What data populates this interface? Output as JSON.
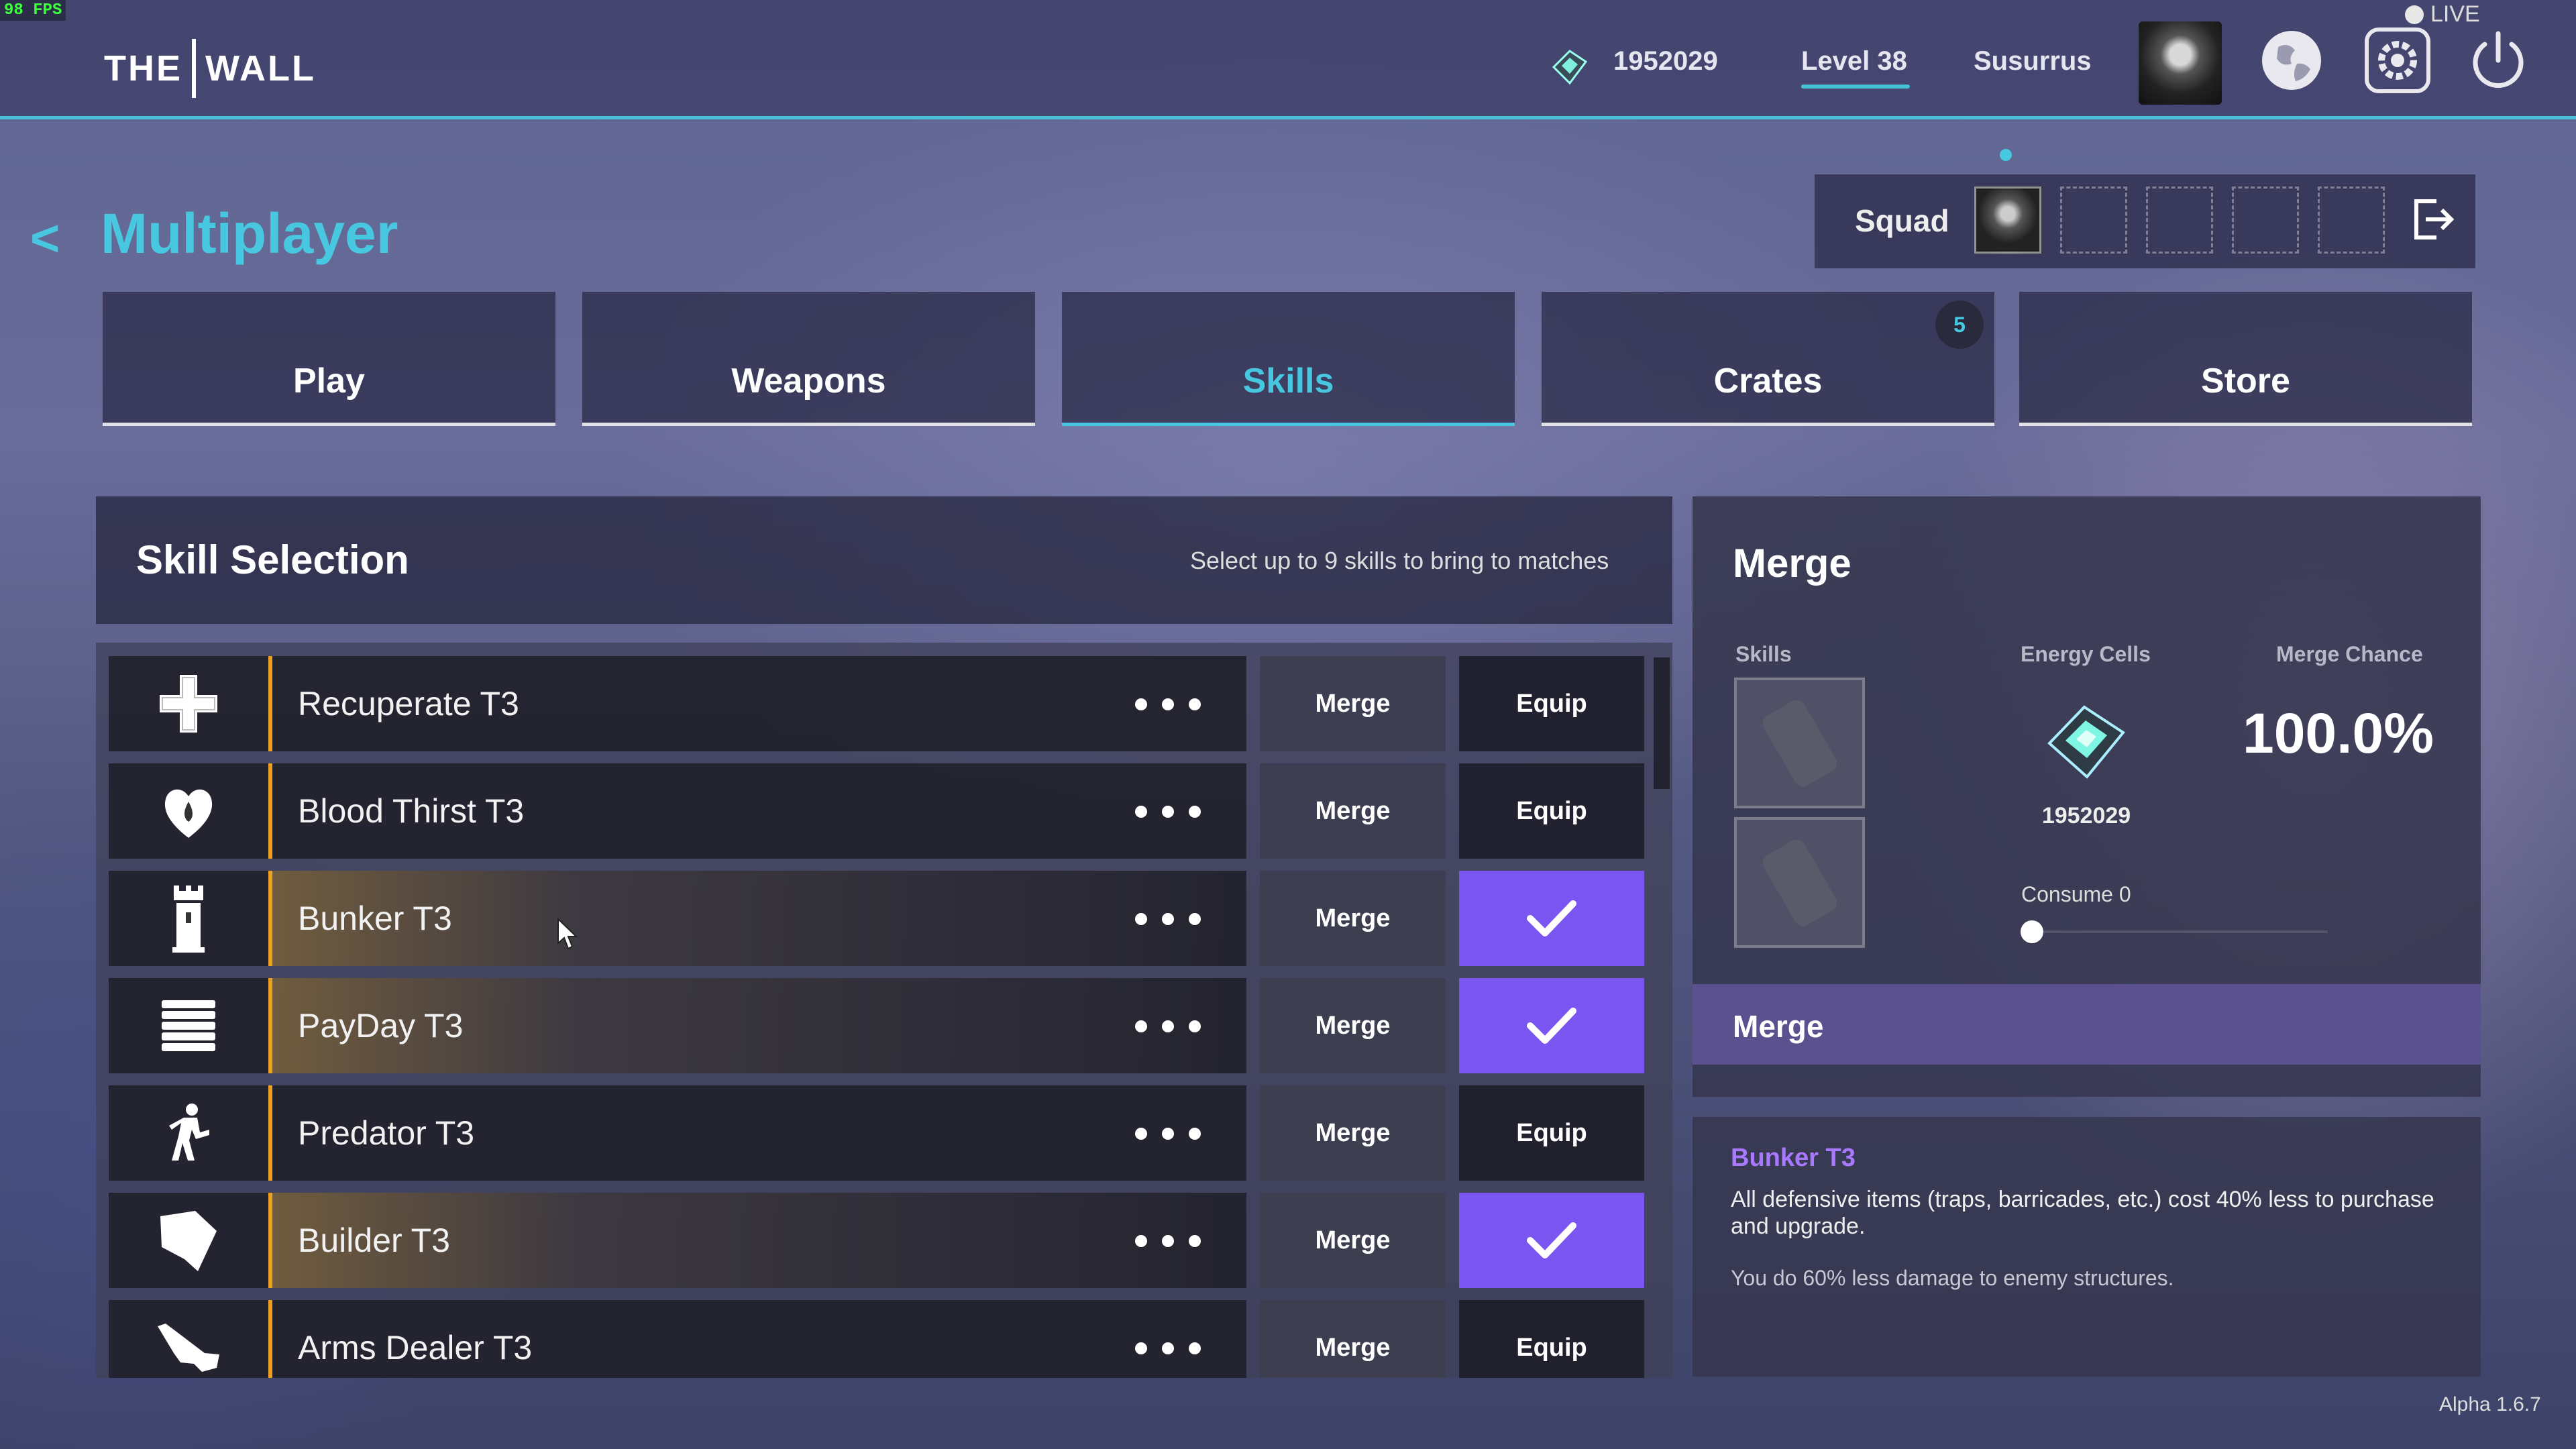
{
  "fps": "98 FPS",
  "header": {
    "logo_left": "THE",
    "logo_right": "WALL",
    "currency": "1952029",
    "level": "Level 38",
    "username": "Susurrus",
    "live": "LIVE",
    "icons": [
      "energy-cell-icon",
      "avatar",
      "globe-icon",
      "gear-icon",
      "power-icon"
    ]
  },
  "page": {
    "back_label": "<",
    "title": "Multiplayer"
  },
  "squad": {
    "label": "Squad"
  },
  "tabs": [
    {
      "label": "Play"
    },
    {
      "label": "Weapons"
    },
    {
      "label": "Skills",
      "active": true
    },
    {
      "label": "Crates",
      "badge": "5"
    },
    {
      "label": "Store"
    }
  ],
  "skill_selection": {
    "title": "Skill Selection",
    "subtitle": "Select up to 9 skills to bring to matches",
    "merge_label": "Merge",
    "equip_label": "Equip",
    "skills": [
      {
        "name": "Recuperate T3",
        "icon": "plus-icon",
        "equipped": false
      },
      {
        "name": "Blood Thirst T3",
        "icon": "blood-heart-icon",
        "equipped": false
      },
      {
        "name": "Bunker T3",
        "icon": "tower-icon",
        "equipped": true
      },
      {
        "name": "PayDay T3",
        "icon": "coin-stack-icon",
        "equipped": true
      },
      {
        "name": "Predator T3",
        "icon": "running-figure-icon",
        "equipped": false
      },
      {
        "name": "Builder T3",
        "icon": "build-flag-icon",
        "equipped": true
      },
      {
        "name": "Arms Dealer T3",
        "icon": "pistol-icon",
        "equipped": false
      }
    ]
  },
  "merge_panel": {
    "title": "Merge",
    "skills_label": "Skills",
    "energy_label": "Energy Cells",
    "chance_label": "Merge Chance",
    "energy_value": "1952029",
    "chance_value": "100.0%",
    "consume_label": "Consume 0",
    "consume_value": 0,
    "button_label": "Merge"
  },
  "description": {
    "title": "Bunker T3",
    "text": "All defensive items (traps, barricades, etc.) cost 40% less to purchase and upgrade.",
    "note": "You do 60% less damage to enemy structures."
  },
  "version": "Alpha 1.6.7",
  "colors": {
    "accent": "#48c8e0",
    "equipped": "#7a55f0",
    "tier_bar": "#f0a020",
    "desc_title": "#a878ff"
  }
}
